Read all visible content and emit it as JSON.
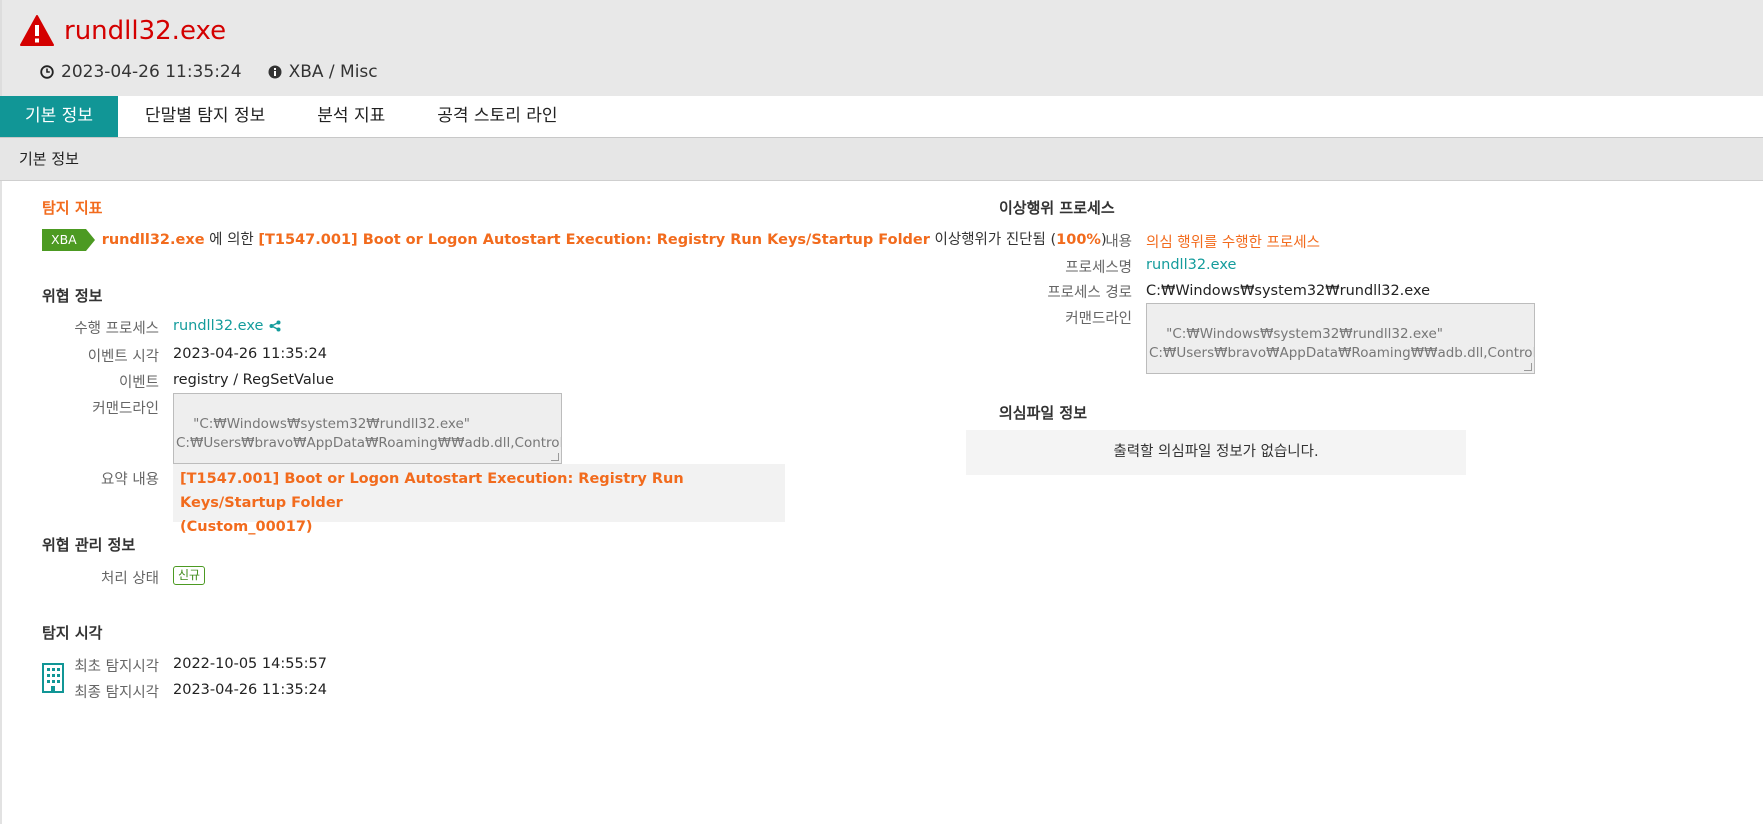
{
  "header": {
    "title": "rundll32.exe",
    "datetime": "2023-04-26 11:35:24",
    "category": "XBA / Misc"
  },
  "tabs": [
    {
      "label": "기본 정보",
      "active": true
    },
    {
      "label": "단말별 탐지 정보",
      "active": false
    },
    {
      "label": "분석 지표",
      "active": false
    },
    {
      "label": "공격 스토리 라인",
      "active": false
    }
  ],
  "subbar": {
    "label": "기본 정보"
  },
  "detection": {
    "title": "탐지 지표",
    "tag": "XBA",
    "process": "rundll32.exe",
    "by_text": "에 의한",
    "technique": "[T1547.001] Boot or Logon Autostart Execution: Registry Run Keys/Startup Folder",
    "diag_text": "이상행위가 진단됨 (",
    "percent": "100%",
    "close_paren": ")"
  },
  "threat": {
    "title": "위협 정보",
    "process_label": "수행 프로세스",
    "process_value": "rundll32.exe",
    "event_time_label": "이벤트 시각",
    "event_time_value": "2023-04-26 11:35:24",
    "event_label": "이벤트",
    "event_value": "registry / RegSetValue",
    "cmd_label": "커맨드라인",
    "cmd_value": "\"C:₩Windows₩system32₩rundll32.exe\"\nC:₩Users₩bravo₩AppData₩Roaming₩₩adb.dll,Control_RunDLL",
    "summary_label": "요약 내용",
    "summary_line1": "[T1547.001] Boot or Logon Autostart Execution: Registry Run Keys/Startup Folder",
    "summary_line2": "(Custom_00017)"
  },
  "threat_mgmt": {
    "title": "위협 관리 정보",
    "status_label": "처리 상태",
    "status_value": "신규"
  },
  "detect_time": {
    "title": "탐지 시각",
    "first_label": "최초 탐지시각",
    "first_value": "2022-10-05 14:55:57",
    "last_label": "최종 탐지시각",
    "last_value": "2023-04-26 11:35:24"
  },
  "abnormal_process": {
    "title": "이상행위 프로세스",
    "content_label": "내용",
    "content_value": "의심 행위를 수행한 프로세스",
    "name_label": "프로세스명",
    "name_value": "rundll32.exe",
    "path_label": "프로세스 경로",
    "path_value": "C:₩Windows₩system32₩rundll32.exe",
    "cmd_label": "커맨드라인",
    "cmd_value": "\"C:₩Windows₩system32₩rundll32.exe\"\nC:₩Users₩bravo₩AppData₩Roaming₩₩adb.dll,Control_RunDLL"
  },
  "suspicious_file": {
    "title": "의심파일 정보",
    "empty_message": "출력할 의심파일 정보가 없습니다."
  },
  "icons": {
    "title": "warning-icon",
    "datetime": "clock-icon",
    "category": "info-icon",
    "share": "share-icon",
    "building": "building-icon"
  },
  "colors": {
    "title_red": "#d40000",
    "tab_active": "#119696",
    "accent_orange": "#f26b1d",
    "link_teal": "#149c9c",
    "tag_green": "#4c9a22"
  }
}
